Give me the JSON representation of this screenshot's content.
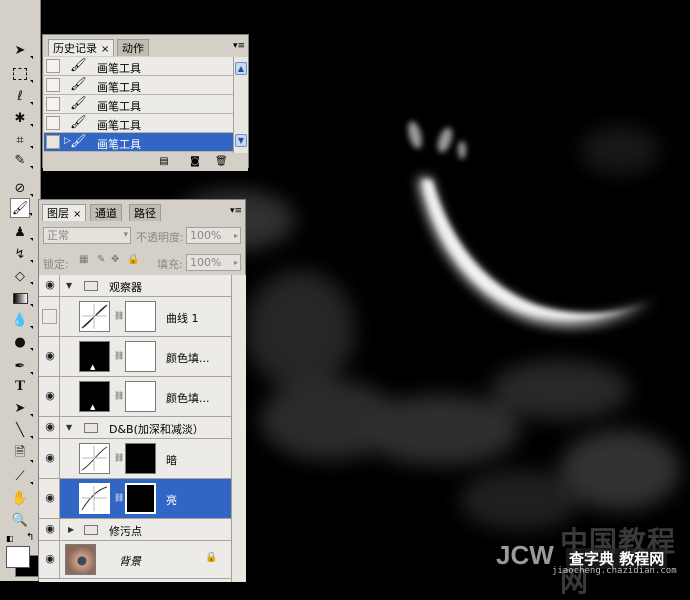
{
  "history_panel": {
    "tabs": [
      {
        "label": "历史记录",
        "close": "×",
        "active": true
      },
      {
        "label": "动作",
        "active": false
      }
    ],
    "items": [
      {
        "icon": "brush-icon",
        "label": "画笔工具"
      },
      {
        "icon": "brush-icon",
        "label": "画笔工具"
      },
      {
        "icon": "brush-icon",
        "label": "画笔工具"
      },
      {
        "icon": "brush-icon",
        "label": "画笔工具"
      },
      {
        "icon": "brush-icon",
        "label": "画笔工具",
        "selected": true
      }
    ]
  },
  "layers_panel": {
    "tabs": [
      {
        "label": "图层",
        "close": "×",
        "active": true
      },
      {
        "label": "通道",
        "active": false
      },
      {
        "label": "路径",
        "active": false
      }
    ],
    "blend_mode": "正常",
    "opacity_label": "不透明度:",
    "opacity_value": "100%",
    "lock_label": "锁定:",
    "fill_label": "填充:",
    "fill_value": "100%",
    "layers": [
      {
        "type": "group",
        "name": "观察器",
        "expanded": true,
        "visible": true
      },
      {
        "type": "adjustment",
        "name": "曲线 1",
        "visible": false
      },
      {
        "type": "fill",
        "name": "颜色填...",
        "visible": true
      },
      {
        "type": "fill",
        "name": "颜色填...",
        "visible": true
      },
      {
        "type": "group",
        "name": "D&B(加深和减淡）",
        "expanded": true,
        "visible": true
      },
      {
        "type": "adjustment",
        "name": "暗",
        "visible": true
      },
      {
        "type": "adjustment",
        "name": "亮",
        "visible": true,
        "selected": true
      },
      {
        "type": "group",
        "name": "修污点",
        "expanded": false,
        "visible": true
      },
      {
        "type": "image",
        "name": "背景",
        "visible": true,
        "locked": true
      }
    ]
  },
  "toolbox": {
    "tools": [
      "move-tool",
      "marquee-tool",
      "lasso-tool",
      "magic-wand-tool",
      "crop-tool",
      "slice-tool",
      "healing-brush-tool",
      "brush-tool",
      "clone-stamp-tool",
      "history-brush-tool",
      "eraser-tool",
      "gradient-tool",
      "blur-tool",
      "dodge-tool",
      "pen-tool",
      "type-tool",
      "path-selection-tool",
      "line-tool",
      "notes-tool",
      "eyedropper-tool",
      "hand-tool",
      "zoom-tool"
    ],
    "active_tool": "brush-tool",
    "type_tool_glyph": "T"
  },
  "watermark": {
    "cn": "中国教程网",
    "en": "JCW",
    "overlay": "查字典 教程网",
    "url": "jiaocheng.chazidian.com"
  }
}
